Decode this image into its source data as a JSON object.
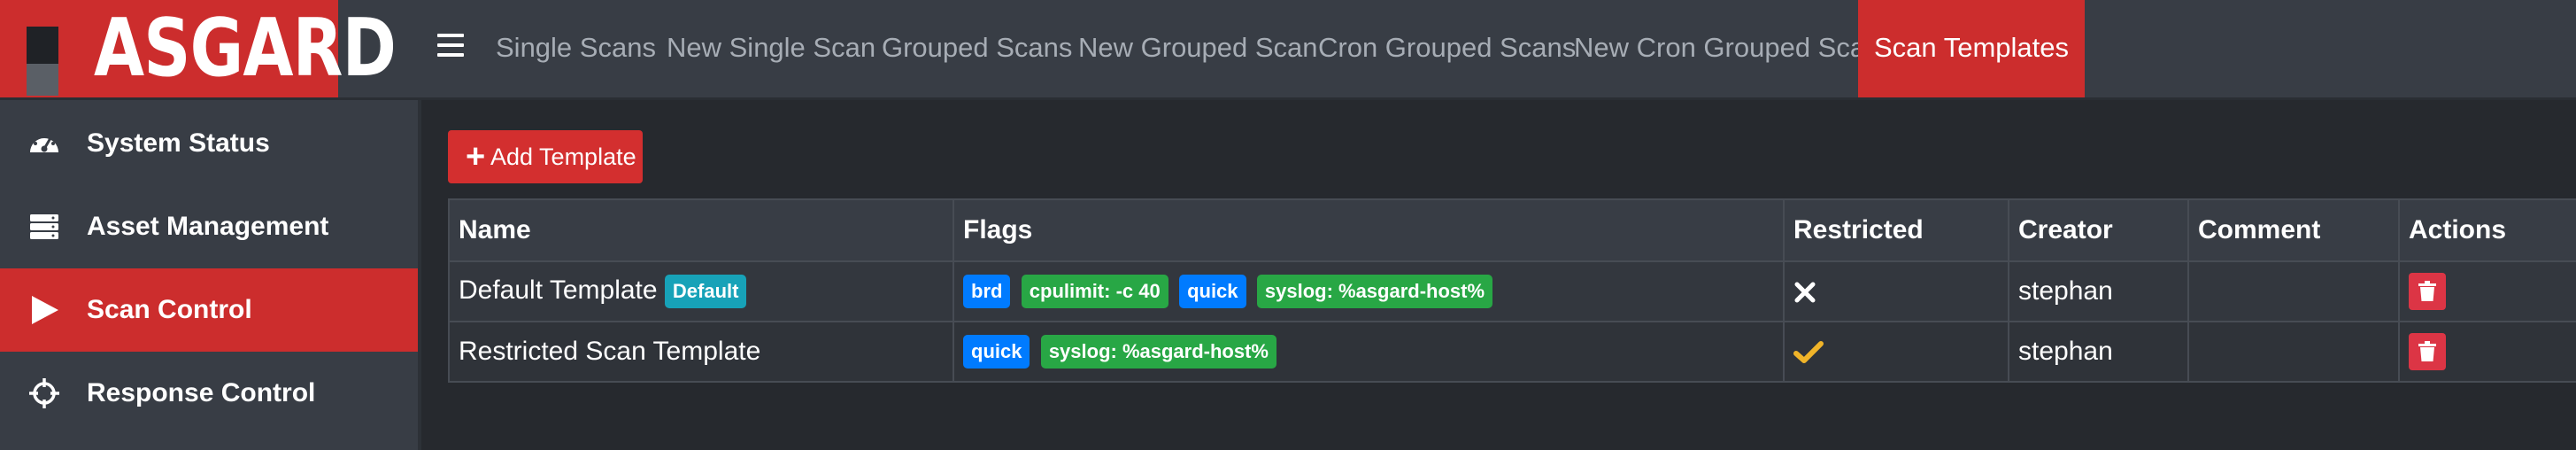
{
  "app": {
    "logo_text": "ASGARD"
  },
  "topnav": {
    "menu_icon": "hamburger-icon",
    "items": [
      {
        "label": "Single Scans"
      },
      {
        "label": "New Single Scan"
      },
      {
        "label": "Grouped Scans"
      },
      {
        "label": "New Grouped Scan"
      },
      {
        "label": "Cron Grouped Scans"
      },
      {
        "label": "New Cron Grouped Scan"
      },
      {
        "label": "Scan Templates",
        "active": true
      }
    ]
  },
  "sidebar": {
    "items": [
      {
        "label": "System Status",
        "icon": "dashboard-gauge-icon"
      },
      {
        "label": "Asset Management",
        "icon": "server-icon"
      },
      {
        "label": "Scan Control",
        "icon": "play-icon",
        "active": true
      },
      {
        "label": "Response Control",
        "icon": "crosshair-icon"
      }
    ]
  },
  "main": {
    "add_button_label": "Add Template",
    "add_button_icon": "plus-icon",
    "table": {
      "headers": [
        "Name",
        "Flags",
        "Restricted",
        "Creator",
        "Comment",
        "Actions"
      ],
      "rows": [
        {
          "name": "Default Template",
          "name_badge": "Default",
          "flags": [
            "brd",
            "cpulimit: -c 40",
            "quick",
            "syslog: %asgard-host%"
          ],
          "restricted_icon": "cross-icon",
          "creator": "stephan",
          "comment": "",
          "action_icon": "trash-icon"
        },
        {
          "name": "Restricted Scan Template",
          "flags": [
            "quick",
            "syslog: %asgard-host%"
          ],
          "restricted_icon": "checkmark-icon",
          "creator": "stephan",
          "comment": "",
          "action_icon": "trash-icon"
        }
      ]
    }
  },
  "colors": {
    "accent_red": "#cc2d2d",
    "badge_teal": "#17a2b8",
    "badge_blue": "#007bff",
    "badge_green": "#28a745",
    "check_yellow": "#f0b429"
  }
}
